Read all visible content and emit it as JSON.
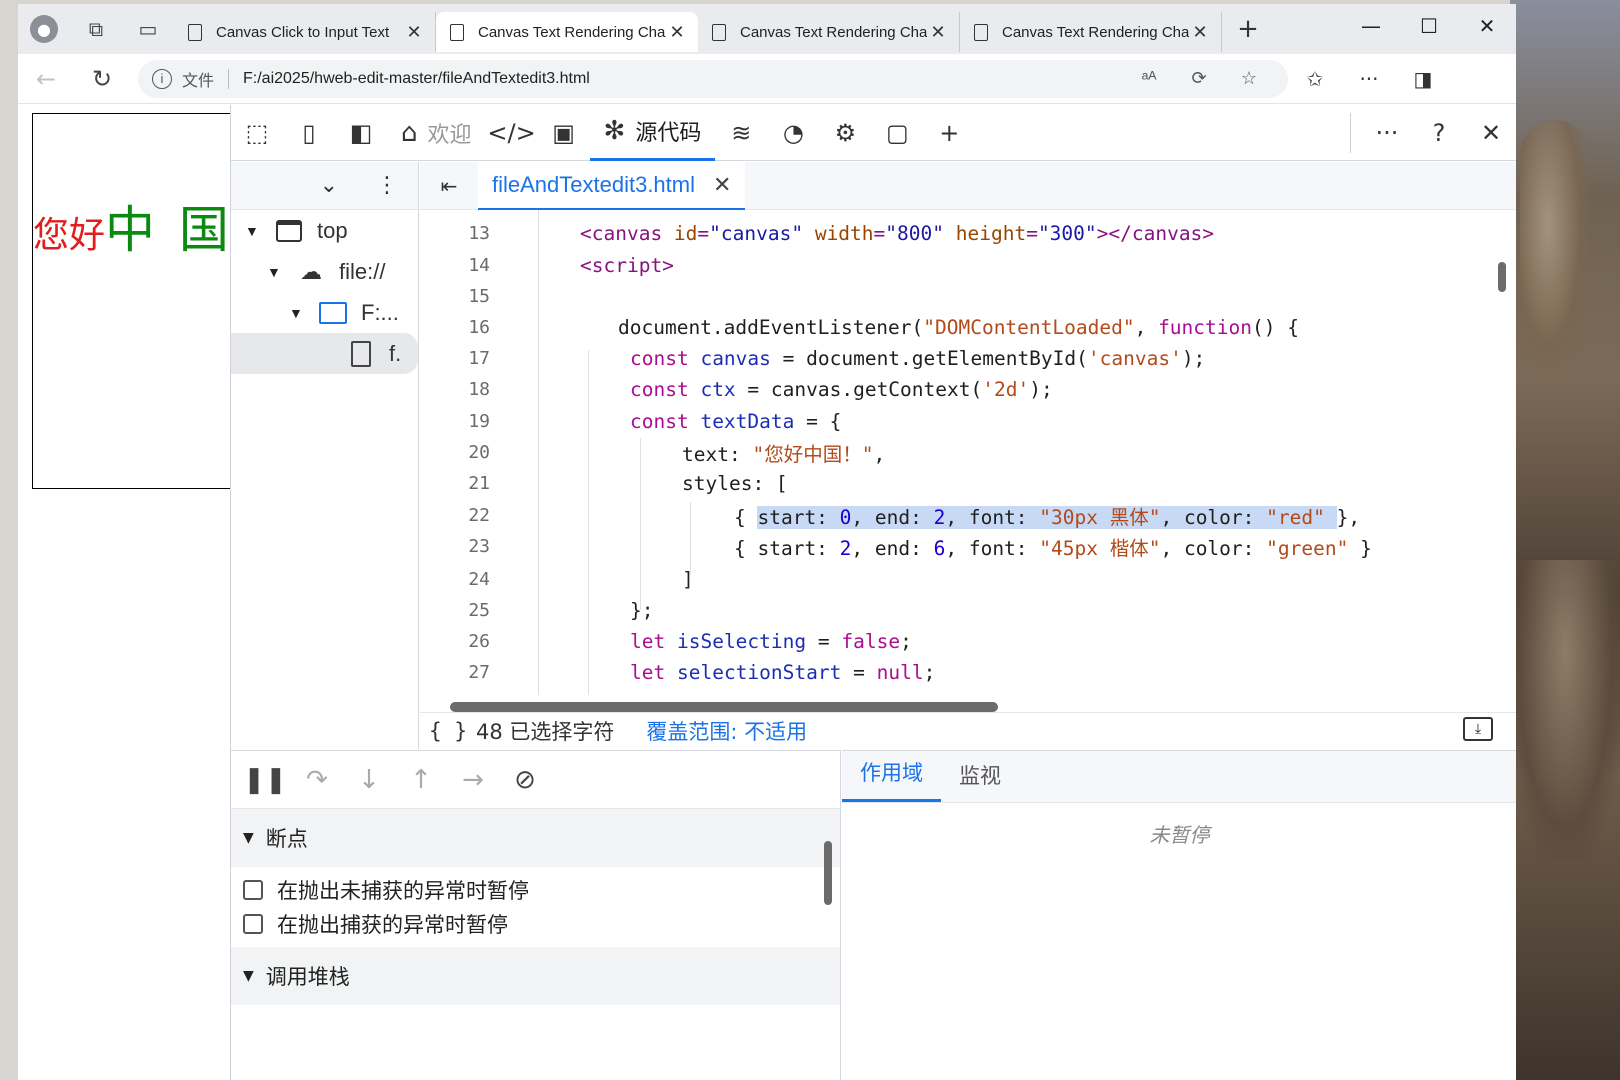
{
  "browser": {
    "tabs": [
      {
        "title": "Canvas Click to Input Text",
        "active": false
      },
      {
        "title": "Canvas Text Rendering Cha",
        "active": true
      },
      {
        "title": "Canvas Text Rendering Cha",
        "active": false
      },
      {
        "title": "Canvas Text Rendering Cha",
        "active": false
      }
    ],
    "address": {
      "scheme_label": "文件",
      "url": "F:/ai2025/hweb-edit-master/fileAndTextedit3.html"
    }
  },
  "canvas_render": {
    "red_text": "您好",
    "green_text": "中 国",
    "red_color": "#e11d1d",
    "green_color": "#0a8a10"
  },
  "devtools": {
    "toolbar": {
      "welcome": "欢迎",
      "sources": "源代码"
    },
    "navigator": {
      "nodes": [
        {
          "label": "top"
        },
        {
          "label": "file://"
        },
        {
          "label": "F:..."
        },
        {
          "label": "f."
        }
      ]
    },
    "editor": {
      "file_tab": "fileAndTextedit3.html",
      "line_numbers": [
        "13",
        "14",
        "15",
        "16",
        "17",
        "18",
        "19",
        "20",
        "21",
        "22",
        "23",
        "24",
        "25",
        "26",
        "27"
      ]
    },
    "status": {
      "braces": "{ }",
      "selection": "48 已选择字符",
      "coverage": "覆盖范围: 不适用"
    },
    "debugger": {
      "breakpoints_title": "断点",
      "pause_uncaught": "在抛出未捕获的异常时暂停",
      "pause_caught": "在抛出捕获的异常时暂停",
      "callstack_title": "调用堆栈"
    },
    "scope": {
      "tab_scope": "作用域",
      "tab_watch": "监视",
      "not_paused": "未暂停"
    }
  },
  "colors": {
    "accent": "#1a73e8",
    "selection": "#c8d9f5"
  }
}
